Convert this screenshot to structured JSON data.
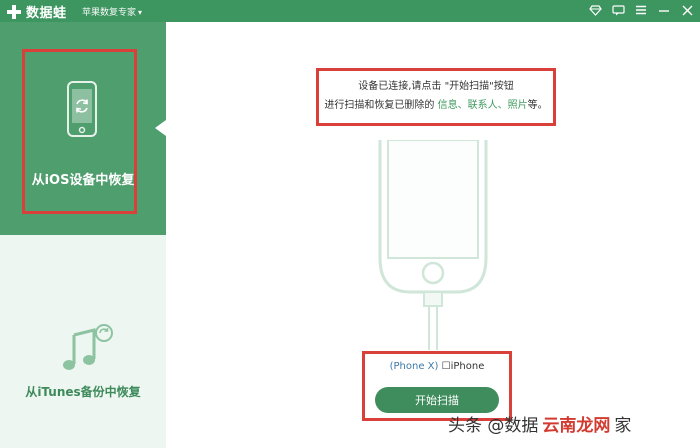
{
  "titlebar": {
    "brand_name": "数据蛙",
    "product_name": "苹果数复专家",
    "controls": [
      "diamond-icon",
      "message-icon",
      "menu-icon",
      "minimize-icon",
      "close-icon"
    ]
  },
  "sidebar": {
    "items": [
      {
        "label": "从iOS设备中恢复",
        "icon": "phone-refresh-icon",
        "active": true
      },
      {
        "label": "从iTunes备份中恢复",
        "icon": "music-note-refresh-icon",
        "active": false
      }
    ]
  },
  "main": {
    "message_line1": "设备已连接,请点击 \"开始扫描\"按钮",
    "message_line2_prefix": "进行扫描和恢复已删除的 ",
    "message_keywords": "信息、联系人、照片",
    "message_line2_suffix": "等。",
    "device_model": "(Phone X)",
    "device_name": "☐iPhone",
    "scan_button": "开始扫描"
  },
  "watermark": {
    "prefix": "头条 @数据",
    "brand": "云南龙网",
    "suffix": "家"
  },
  "colors": {
    "primary_green": "#3d9560",
    "active_green": "#4f9e6d",
    "highlight_red": "#d9403a",
    "button_green": "#3f8c5c"
  }
}
